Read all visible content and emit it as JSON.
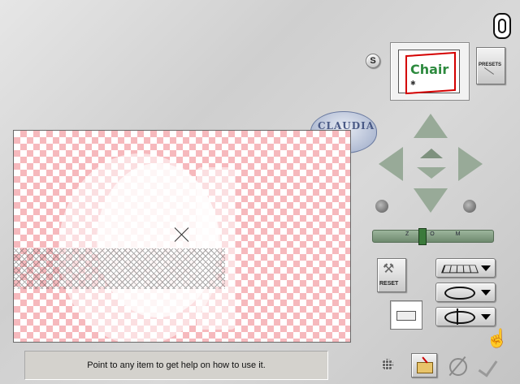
{
  "status_text": "Point to any item to get help on how to use it.",
  "preset_label": "PRESETS",
  "reset_label": "RESET",
  "s_label": "S",
  "logo_text": "CLAUDIA",
  "thumb_text": "Chair",
  "zoom_label": "Z O M",
  "colors": {
    "checker": "#f6b9bd",
    "cursor": "#ff0000",
    "hand": "#e8b400"
  }
}
